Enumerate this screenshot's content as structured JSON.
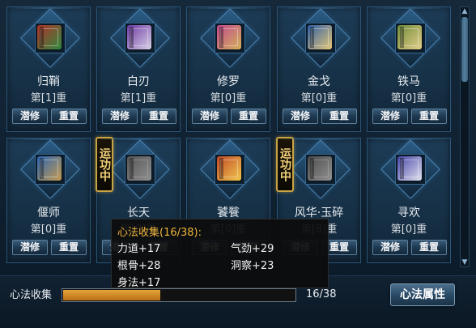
{
  "cards": [
    {
      "name": "归鞘",
      "level": "第[1]重",
      "color": "#b0322b",
      "glyph": "#2e8a3e",
      "running": false,
      "dim": false
    },
    {
      "name": "白刃",
      "level": "第[1]重",
      "color": "#6d3aa3",
      "glyph": "#d8d0e6",
      "running": false,
      "dim": false
    },
    {
      "name": "修罗",
      "level": "第[0]重",
      "color": "#c24a8d",
      "glyph": "#d3b25a",
      "running": false,
      "dim": false
    },
    {
      "name": "金戈",
      "level": "第[0]重",
      "color": "#2f5fa6",
      "glyph": "#e6c878",
      "running": false,
      "dim": false
    },
    {
      "name": "铁马",
      "level": "第[0]重",
      "color": "#6e8a3a",
      "glyph": "#e5d08a",
      "running": false,
      "dim": false
    },
    {
      "name": "偃师",
      "level": "第[0]重",
      "color": "#2d66b3",
      "glyph": "#c49a4e",
      "running": false,
      "dim": false
    },
    {
      "name": "长天",
      "level": "第[0]重",
      "color": "#6c7480",
      "glyph": "#b9c0c8",
      "running": true,
      "dim": true
    },
    {
      "name": "饕餮",
      "level": "第[0]重",
      "color": "#c04a2b",
      "glyph": "#f2c84b",
      "running": false,
      "dim": false
    },
    {
      "name": "风华·玉碎",
      "level": "第[8]重",
      "color": "#5f6570",
      "glyph": "#bcc3cb",
      "running": true,
      "dim": true
    },
    {
      "name": "寻欢",
      "level": "第[0]重",
      "color": "#4646a8",
      "glyph": "#e2e2f0",
      "running": false,
      "dim": false
    }
  ],
  "buttons": {
    "cultivate": "潜修",
    "reset": "重置"
  },
  "running_badge": "运功中",
  "footer": {
    "collect_label": "心法收集",
    "progress_text": "16/38",
    "progress_fraction": 0.421,
    "attr_button": "心法属性"
  },
  "tooltip": {
    "title": "心法收集(16/38):",
    "stats": [
      "力道+17",
      "气劲+29",
      "根骨+28",
      "洞察+23",
      "身法+17"
    ]
  }
}
